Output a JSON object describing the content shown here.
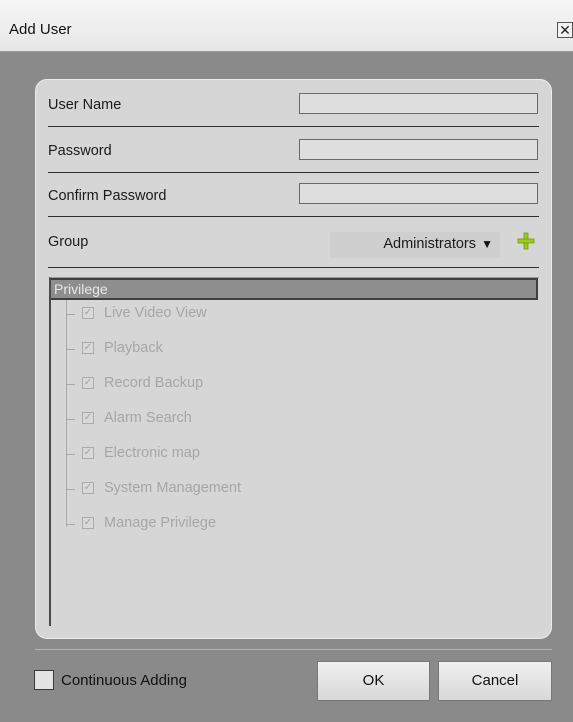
{
  "window": {
    "title": "Add User",
    "close_glyph": "✕"
  },
  "form": {
    "user_name_label": "User Name",
    "user_name_value": "",
    "password_label": "Password",
    "password_value": "",
    "confirm_password_label": "Confirm Password",
    "confirm_password_value": "",
    "group_label": "Group",
    "group_value": "Administrators",
    "add_group_icon": "plus-icon"
  },
  "privilege": {
    "header": "Privilege",
    "items": [
      {
        "label": "Live Video View",
        "checked": true
      },
      {
        "label": "Playback",
        "checked": true
      },
      {
        "label": "Record Backup",
        "checked": true
      },
      {
        "label": "Alarm Search",
        "checked": true
      },
      {
        "label": "Electronic map",
        "checked": true
      },
      {
        "label": "System Management",
        "checked": true
      },
      {
        "label": "Manage Privilege",
        "checked": true
      }
    ]
  },
  "footer": {
    "continuous_label": "Continuous Adding",
    "continuous_checked": false,
    "ok_label": "OK",
    "cancel_label": "Cancel"
  },
  "colors": {
    "accent_plus": "#9acd1c",
    "privilege_header_bg": "#8e8e8e"
  }
}
